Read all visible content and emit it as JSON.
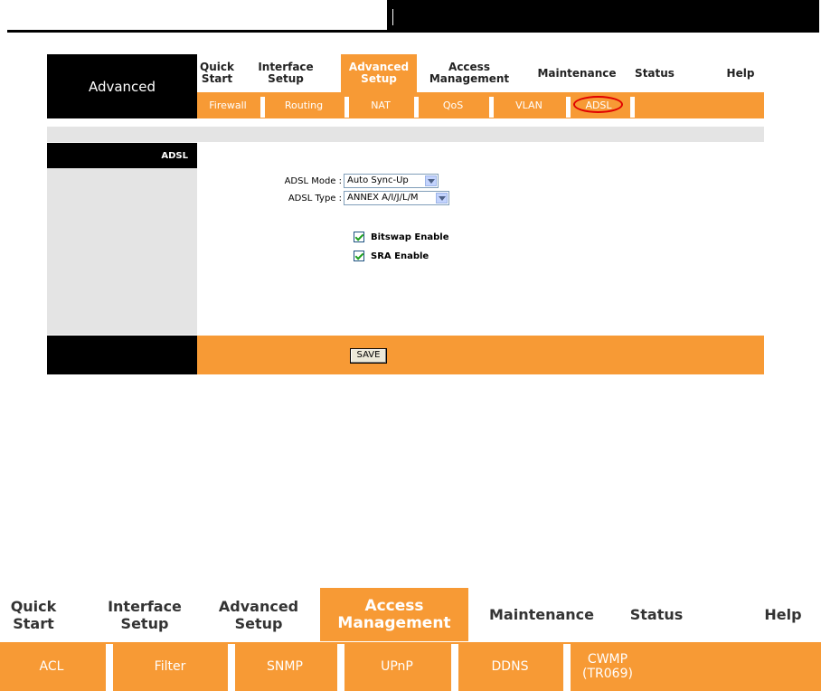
{
  "screenshot1": {
    "brand": "Advanced",
    "nav": [
      {
        "label": "Quick\nStart"
      },
      {
        "label": "Interface\nSetup"
      },
      {
        "label": "Advanced\nSetup",
        "active": true
      },
      {
        "label": "Access\nManagement"
      },
      {
        "label": "Maintenance"
      },
      {
        "label": "Status"
      },
      {
        "label": "Help"
      }
    ],
    "subnav": [
      "Firewall",
      "Routing",
      "NAT",
      "QoS",
      "VLAN",
      "ADSL"
    ],
    "section_title": "ADSL",
    "adsl_mode_label": "ADSL Mode :",
    "adsl_mode_value": "Auto Sync-Up",
    "adsl_type_label": "ADSL Type :",
    "adsl_type_value": "ANNEX A/I/J/L/M",
    "bitswap_label": "Bitswap Enable",
    "bitswap_checked": true,
    "sra_label": "SRA Enable",
    "sra_checked": true,
    "save_label": "SAVE"
  },
  "screenshot2": {
    "nav": [
      {
        "label": "Quick\nStart"
      },
      {
        "label": "Interface\nSetup"
      },
      {
        "label": "Advanced\nSetup"
      },
      {
        "label": "Access\nManagement",
        "active": true
      },
      {
        "label": "Maintenance"
      },
      {
        "label": "Status"
      },
      {
        "label": "Help"
      }
    ],
    "subnav": [
      "ACL",
      "Filter",
      "SNMP",
      "UPnP",
      "DDNS",
      "CWMP\n(TR069)"
    ]
  },
  "colors": {
    "accent": "#f79a35",
    "highlight_circle": "#e00000",
    "dark": "#000000",
    "panel_gray": "#e4e4e4"
  }
}
